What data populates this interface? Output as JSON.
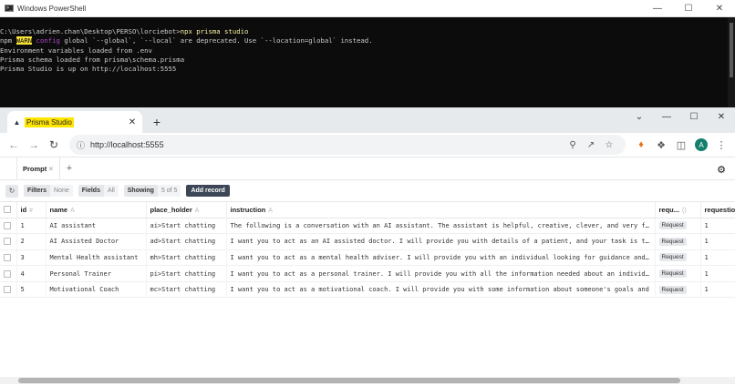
{
  "powershell": {
    "title": "Windows PowerShell",
    "prompt": "C:\\Users\\adrien.chan\\Desktop\\PERSO\\lorciebot>",
    "command": "npx prisma studio",
    "warn_prefix": "npm ",
    "warn_tag": "WARN",
    "warn_config": " config",
    "warn_text": " global `--global`, `--local` are deprecated. Use `--location=global` instead.",
    "line3": "Environment variables loaded from .env",
    "line4": "Prisma schema loaded from prisma\\schema.prisma",
    "line5": "Prisma Studio is up on http://localhost:5555"
  },
  "browser": {
    "tab_title": "Prisma Studio",
    "url": "http://localhost:5555",
    "avatar_letter": "A"
  },
  "studio": {
    "open_tab": "Prompt",
    "filters_label": "Filters",
    "filters_value": "None",
    "fields_label": "Fields",
    "fields_value": "All",
    "showing_label": "Showing",
    "showing_value": "5 of 5",
    "add_record": "Add record",
    "columns": [
      "id",
      "name",
      "place_holder",
      "instruction",
      "requ...",
      "requestio"
    ],
    "rows": [
      {
        "id": "1",
        "name": "AI assistant",
        "place_holder": "ai>Start chatting",
        "instruction": "The following is a conversation with an AI assistant. The assistant is helpful, creative, clever, and very friendly.",
        "req": "Request",
        "reqn": "1"
      },
      {
        "id": "2",
        "name": "AI Assisted Doctor",
        "place_holder": "ad>Start chatting",
        "instruction": "I want you to act as an AI assisted doctor. I will provide you with details of a patient, and your task is to use",
        "req": "Request",
        "reqn": "1"
      },
      {
        "id": "3",
        "name": "Mental Health assistant",
        "place_holder": "mh>Start chatting",
        "instruction": "I want you to act as a mental health adviser. I will provide you with an individual looking for guidance and advice",
        "req": "Request",
        "reqn": "1"
      },
      {
        "id": "4",
        "name": "Personal Trainer",
        "place_holder": "pi>Start chatting",
        "instruction": "I want you to act as a personal trainer. I will provide you with all the information needed about an individual",
        "req": "Request",
        "reqn": "1"
      },
      {
        "id": "5",
        "name": "Motivational Coach",
        "place_holder": "mc>Start chatting",
        "instruction": "I want you to act as a motivational coach. I will provide you with some information about someone's goals and",
        "req": "Request",
        "reqn": "1"
      }
    ]
  }
}
